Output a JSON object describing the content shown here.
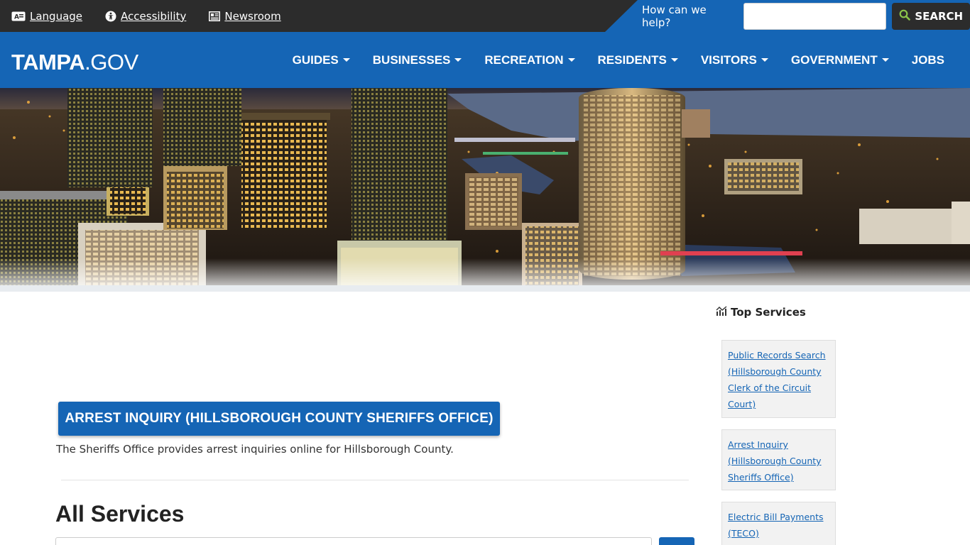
{
  "utility": {
    "language": "Language",
    "accessibility": "Accessibility",
    "newsroom": "Newsroom"
  },
  "search": {
    "prompt": "How can we help?",
    "placeholder": "",
    "button": "SEARCH"
  },
  "logo": {
    "bold": "TAMPA",
    "light": ".GOV"
  },
  "nav": {
    "items": [
      {
        "label": "GUIDES"
      },
      {
        "label": "BUSINESSES"
      },
      {
        "label": "RECREATION"
      },
      {
        "label": "RESIDENTS"
      },
      {
        "label": "VISITORS"
      },
      {
        "label": "GOVERNMENT"
      },
      {
        "label": "JOBS"
      }
    ]
  },
  "main": {
    "arrest_button": "ARREST INQUIRY (HILLSBOROUGH COUNTY SHERIFFS OFFICE)",
    "arrest_desc": "The Sheriffs Office provides arrest inquiries online for Hillsborough County.",
    "all_services_title": "All Services"
  },
  "sidebar": {
    "heading": "Top Services",
    "services": [
      {
        "label": "Public Records Search (Hillsborough County Clerk of the Circuit Court)"
      },
      {
        "label": "Arrest Inquiry (Hillsborough County Sheriffs Office)"
      },
      {
        "label": "Electric Bill Payments (TECO)"
      }
    ]
  },
  "colors": {
    "brand_blue": "#1565b5",
    "utility_dark": "#2c2c2c",
    "search_icon_green": "#8bc34a"
  },
  "icons": [
    "language-icon",
    "accessibility-icon",
    "newspaper-icon",
    "search-icon",
    "trending-chart-icon",
    "chevron-down-icon"
  ]
}
